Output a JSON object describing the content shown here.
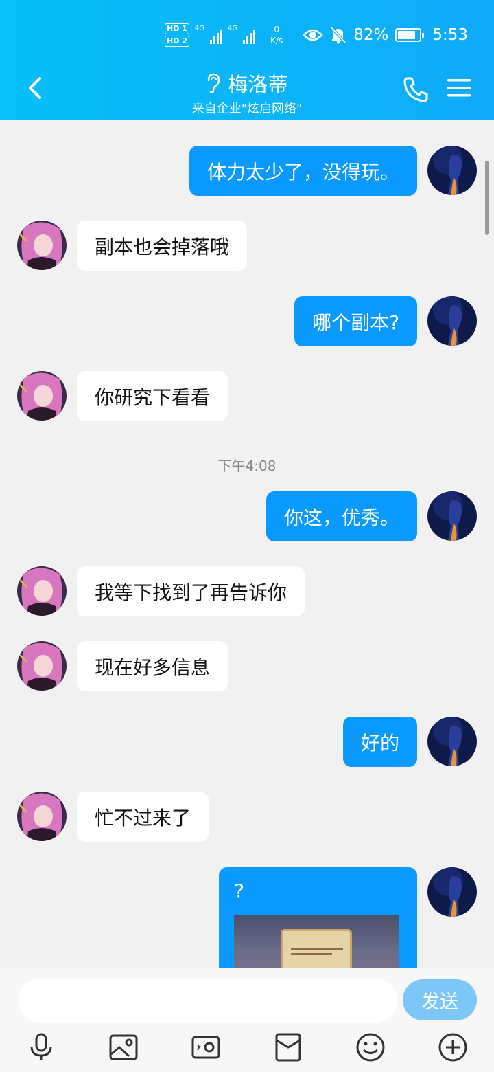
{
  "status_bar": {
    "hd1": "HD 1",
    "hd2": "HD 2",
    "sim1": "4G",
    "sim2": "4G",
    "net_speed": "0",
    "net_unit": "K/s",
    "battery": "82%",
    "battery_level": 0.82,
    "time": "5:53"
  },
  "header": {
    "title": "梅洛蒂",
    "subtitle": "来自企业\"炫启网络\""
  },
  "icons": {
    "back": "chevron-left-icon",
    "earpiece": "ear-icon",
    "call": "phone-icon",
    "menu": "menu-icon",
    "voice": "microphone-icon",
    "image": "image-icon",
    "camera": "camera-icon",
    "red_packet": "red-packet-icon",
    "emoji": "emoji-icon",
    "more": "plus-circle-icon"
  },
  "colors": {
    "header": "#10aaf9",
    "outgoing_bubble": "#0a99ff",
    "incoming_bubble": "#ffffff",
    "send_button": "#7cc7f7"
  },
  "messages": [
    {
      "dir": "out",
      "text": "体力太少了，没得玩。"
    },
    {
      "dir": "in",
      "text": "副本也会掉落哦"
    },
    {
      "dir": "out",
      "text": "哪个副本?"
    },
    {
      "dir": "in",
      "text": "你研究下看看"
    },
    {
      "dir": "time",
      "text": "下午4:08"
    },
    {
      "dir": "out",
      "text": "你这，优秀。"
    },
    {
      "dir": "in",
      "text": "我等下找到了再告诉你"
    },
    {
      "dir": "in",
      "text": "现在好多信息"
    },
    {
      "dir": "out",
      "text": "好的"
    },
    {
      "dir": "in",
      "text": "忙不过来了"
    },
    {
      "dir": "out",
      "text": "?",
      "has_image": true
    }
  ],
  "composer": {
    "input_value": "",
    "send_label": "发送"
  }
}
